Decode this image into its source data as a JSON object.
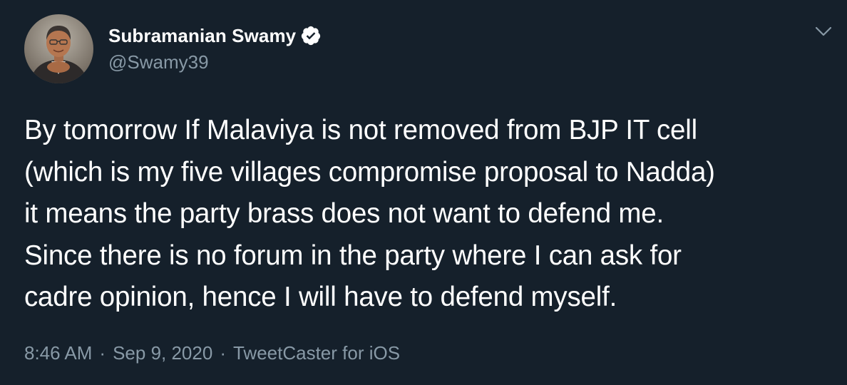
{
  "user": {
    "display_name": "Subramanian Swamy",
    "handle": "@Swamy39",
    "verified": true
  },
  "tweet": {
    "text": "By tomorrow If Malaviya is not removed from BJP IT cell\n(which is my five villages compromise proposal to Nadda)\nit means the party brass does not want to defend me.\nSince there is no forum in the party where I can ask for\ncadre opinion, hence I will have to defend myself.",
    "time": "8:46 AM",
    "date": "Sep 9, 2020",
    "source": "TweetCaster for iOS",
    "separator": "·"
  },
  "icons": {
    "avatar": "profile-photo",
    "verified": "verified-badge-icon",
    "menu": "chevron-down-icon"
  },
  "colors": {
    "background": "#15202b",
    "text": "#ffffff",
    "secondary": "#8899a6"
  }
}
